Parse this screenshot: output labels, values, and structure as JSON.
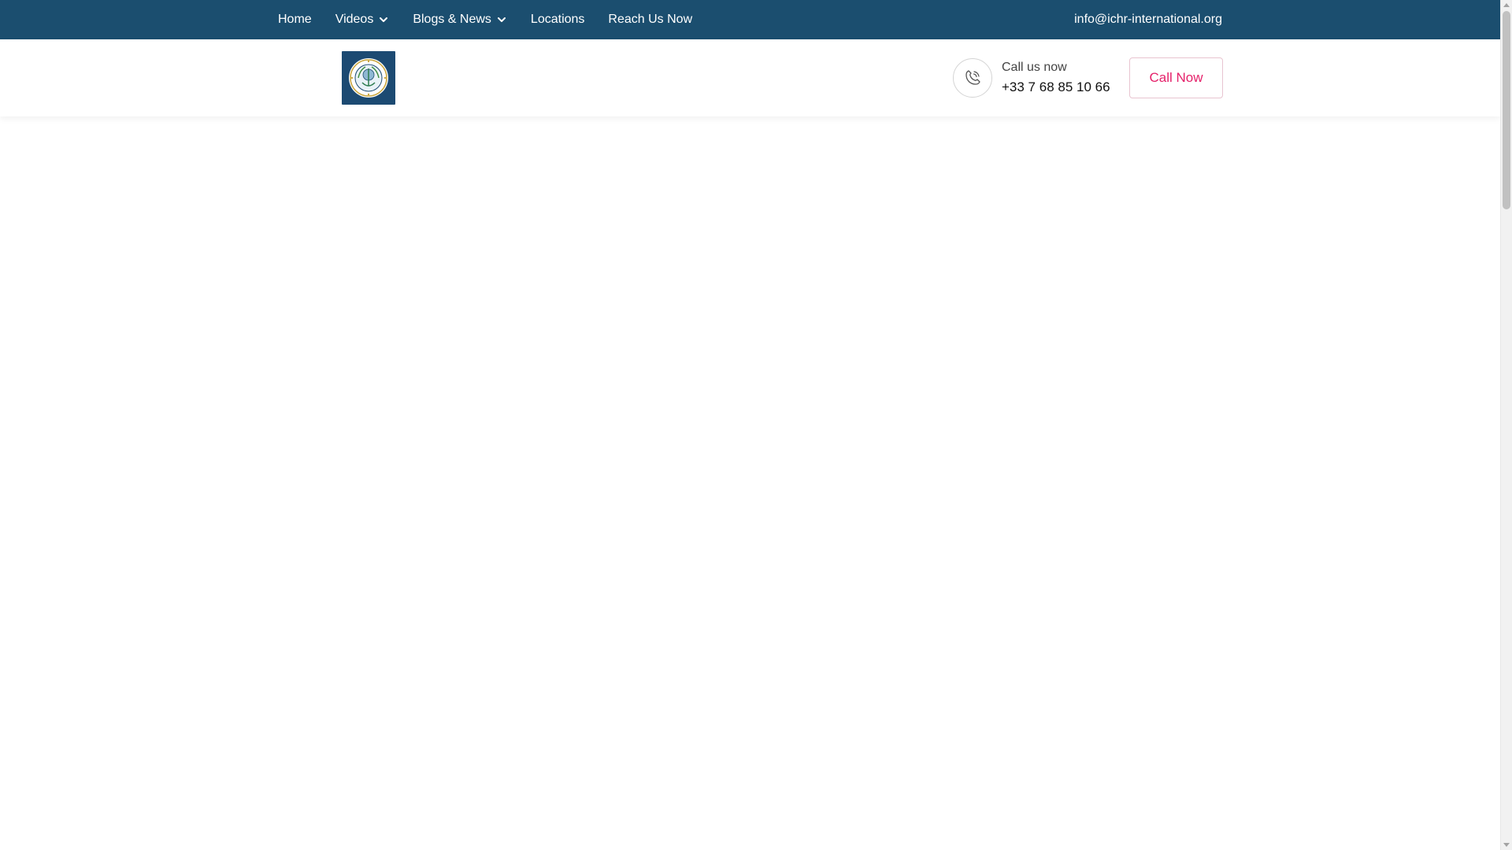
{
  "topbar": {
    "nav": [
      {
        "label": "Home",
        "has_dropdown": false
      },
      {
        "label": "Videos",
        "has_dropdown": true
      },
      {
        "label": "Blogs & News",
        "has_dropdown": true
      },
      {
        "label": "Locations",
        "has_dropdown": false
      },
      {
        "label": "Reach Us Now",
        "has_dropdown": false
      }
    ],
    "email": "info@ichr-international.org",
    "background_color": "#1b4e6f"
  },
  "header": {
    "logo_icon": "ichr-seal-logo",
    "call": {
      "icon": "phone-icon",
      "label": "Call us now",
      "number": "+33 7 68 85 10 66"
    },
    "call_button_label": "Call Now",
    "accent_color": "#e5216a"
  },
  "colors": {
    "nav_text": "#ffffff",
    "logo_bg": "#1c4a72"
  }
}
